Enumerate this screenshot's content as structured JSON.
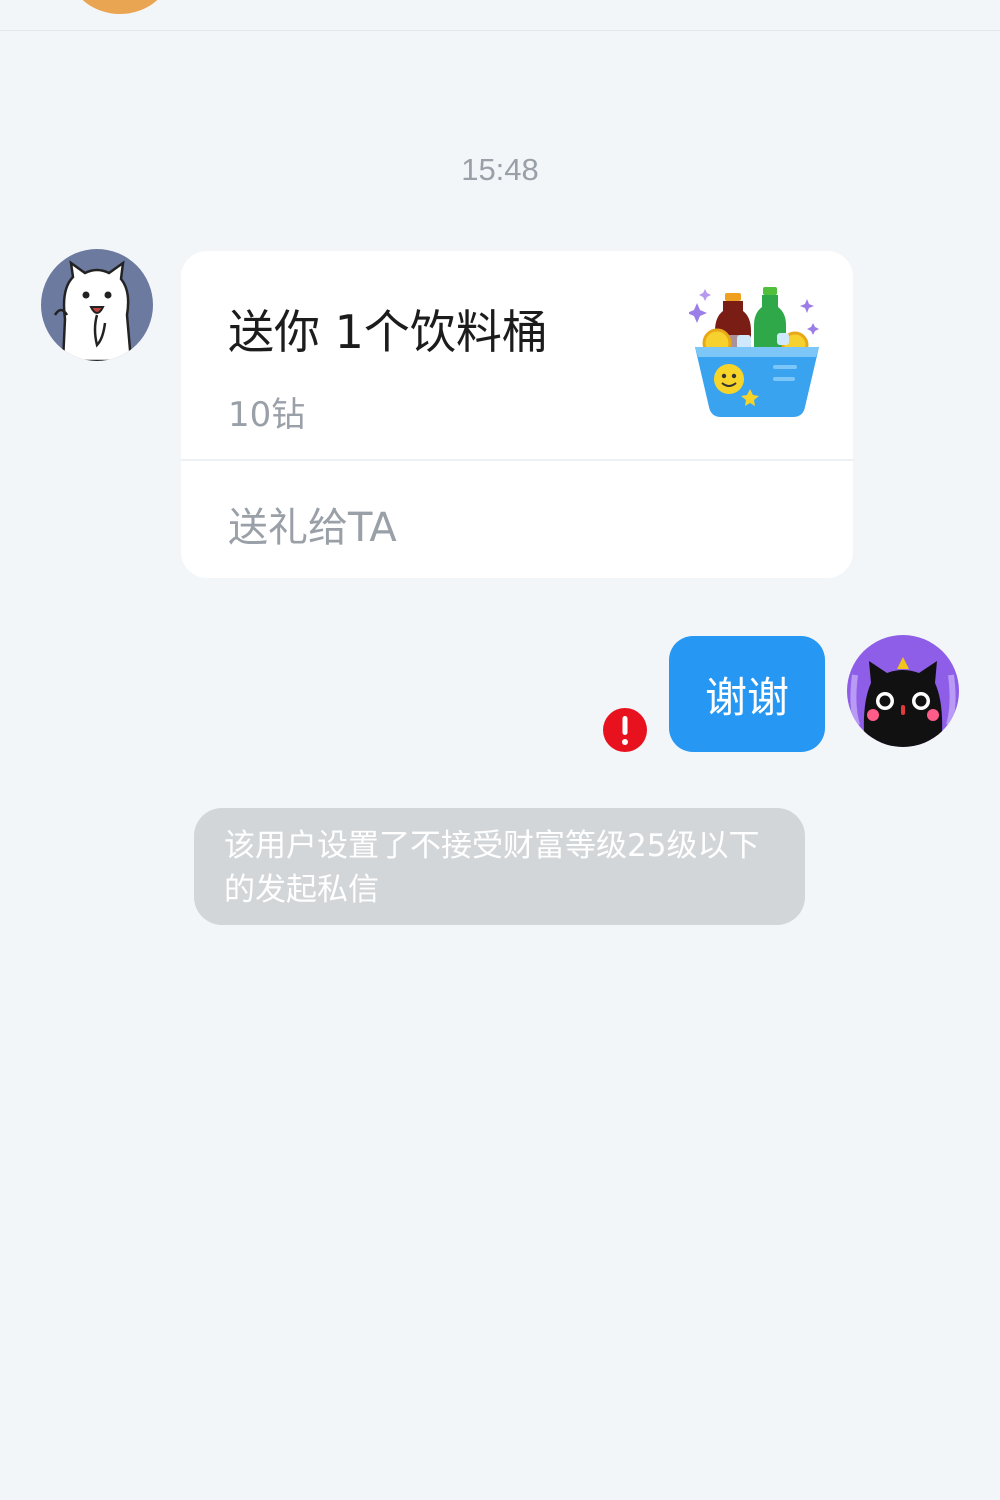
{
  "chat": {
    "timestamp": "15:48",
    "gift_card": {
      "title": "送你 1个饮料桶",
      "price": "10钻",
      "action_label": "送礼给TA",
      "gift_icon": "drink-bucket-icon"
    },
    "outgoing_message": {
      "text": "谢谢",
      "status_icon": "error-icon"
    },
    "system_notice": "该用户设置了不接受财富等级25级以下的发起私信"
  },
  "colors": {
    "background": "#f3f6f9",
    "bubble_blue": "#2697f2",
    "error_red": "#e8121f",
    "notice_gray": "#d3d6d9",
    "secondary_text": "#9aa0a8"
  }
}
